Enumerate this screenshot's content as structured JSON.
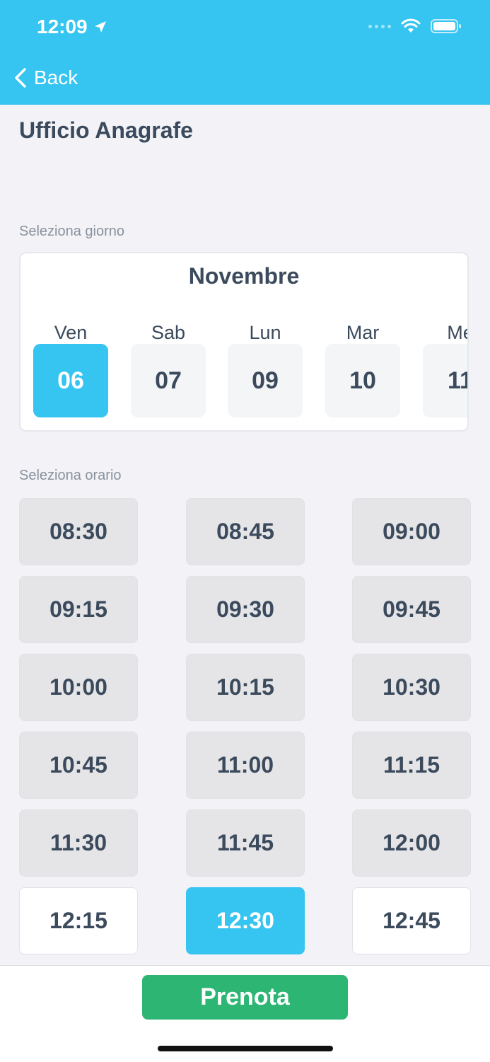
{
  "status_bar": {
    "time": "12:09"
  },
  "nav": {
    "back_label": "Back"
  },
  "page": {
    "title": "Ufficio Anagrafe"
  },
  "day_picker": {
    "label": "Seleziona giorno",
    "month": "Novembre",
    "days": [
      {
        "weekday": "Ven",
        "date": "06",
        "selected": true
      },
      {
        "weekday": "Sab",
        "date": "07",
        "selected": false
      },
      {
        "weekday": "Lun",
        "date": "09",
        "selected": false
      },
      {
        "weekday": "Mar",
        "date": "10",
        "selected": false
      },
      {
        "weekday": "Me",
        "date": "11",
        "selected": false
      }
    ]
  },
  "time_picker": {
    "label": "Seleziona orario",
    "slots": [
      {
        "time": "08:30",
        "state": "unavailable"
      },
      {
        "time": "08:45",
        "state": "unavailable"
      },
      {
        "time": "09:00",
        "state": "unavailable"
      },
      {
        "time": "09:15",
        "state": "unavailable"
      },
      {
        "time": "09:30",
        "state": "unavailable"
      },
      {
        "time": "09:45",
        "state": "unavailable"
      },
      {
        "time": "10:00",
        "state": "unavailable"
      },
      {
        "time": "10:15",
        "state": "unavailable"
      },
      {
        "time": "10:30",
        "state": "unavailable"
      },
      {
        "time": "10:45",
        "state": "unavailable"
      },
      {
        "time": "11:00",
        "state": "unavailable"
      },
      {
        "time": "11:15",
        "state": "unavailable"
      },
      {
        "time": "11:30",
        "state": "unavailable"
      },
      {
        "time": "11:45",
        "state": "unavailable"
      },
      {
        "time": "12:00",
        "state": "unavailable"
      },
      {
        "time": "12:15",
        "state": "available"
      },
      {
        "time": "12:30",
        "state": "selected"
      },
      {
        "time": "12:45",
        "state": "available"
      }
    ]
  },
  "footer": {
    "book_label": "Prenota"
  },
  "colors": {
    "accent": "#36c4f0",
    "book_button": "#2db574",
    "text": "#3b4a5c",
    "slot_unavailable": "#e5e5e7"
  },
  "icons": {
    "location": "location-arrow-icon",
    "wifi": "wifi-icon",
    "battery": "battery-icon",
    "back": "chevron-left-icon"
  }
}
